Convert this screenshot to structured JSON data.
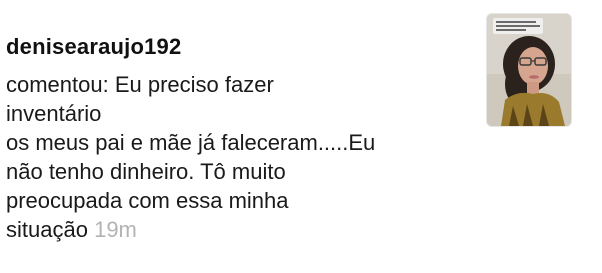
{
  "notification": {
    "username": "denisearaujo192",
    "comment_lines": [
      "comentou: Eu preciso fazer",
      "inventário",
      "os meus pai e mãe já faleceram.....Eu",
      "não tenho dinheiro. Tô muito",
      "preocupada com essa minha",
      "situação"
    ],
    "time": "19m"
  },
  "colors": {
    "text": "#1a1a1a",
    "timestamp": "#b3b3b3",
    "background": "#ffffff"
  }
}
